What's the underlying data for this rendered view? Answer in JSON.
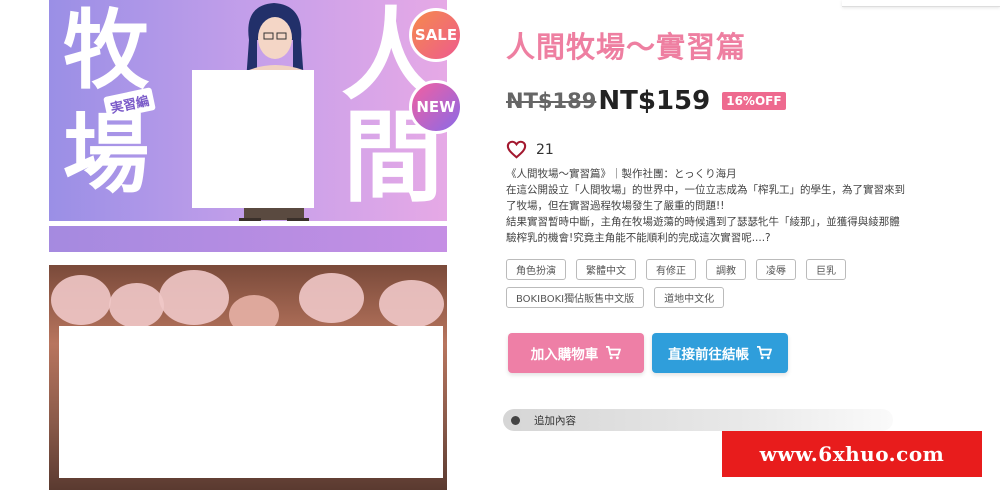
{
  "cover": {
    "kanji": [
      "牧",
      "場",
      "人",
      "間"
    ],
    "subtitle_tag": "実習編",
    "badges": {
      "sale": "SALE",
      "new": "NEW"
    }
  },
  "product": {
    "title": "人間牧場～實習篇",
    "old_price": "NT$189",
    "price": "NT$159",
    "discount": "16%OFF",
    "likes": "21",
    "description": [
      "《人間牧場～實習篇》｜製作社團：とっくり海月",
      "在這公開設立「人間牧場」的世界中，一位立志成為「榨乳工」的學生，為了實習來到",
      "了牧場，但在實習過程牧場發生了嚴重的問題!!",
      "結果實習暫時中斷，主角在牧場遊蕩的時候遇到了瑟瑟牝牛「綾那」，並獲得與綾那體",
      "驗榨乳的機會!究竟主角能不能順利的完成這次實習呢....?"
    ],
    "tags_row1": [
      "角色扮演",
      "繁體中文",
      "有修正",
      "調教",
      "凌辱",
      "巨乳"
    ],
    "tags_row2": [
      "BOKIBOKI獨佔販售中文版",
      "道地中文化"
    ],
    "add_to_cart_label": "加入購物車",
    "checkout_label": "直接前往結帳",
    "extra_section_label": "追加內容"
  },
  "watermark": "www.6xhuo.com",
  "colors": {
    "title_pink": "#ee7fa1",
    "cart_button": "#ee7fa6",
    "checkout_button": "#2f9edb",
    "discount_badge": "#ee6a8f",
    "watermark_bg": "#e81c1c"
  }
}
